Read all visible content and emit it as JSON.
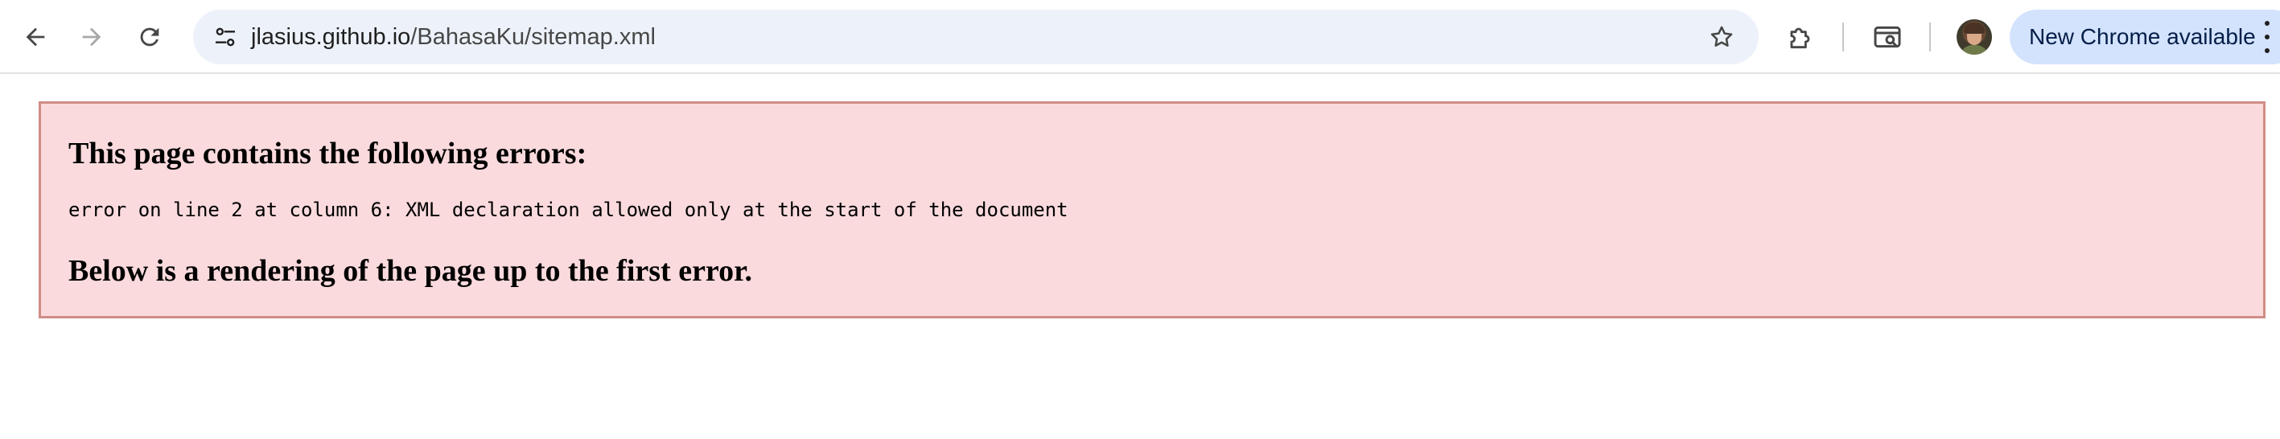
{
  "browser": {
    "nav": {
      "back_icon": "arrow-left-icon",
      "forward_icon": "arrow-right-icon",
      "reload_icon": "reload-icon"
    },
    "omnibox": {
      "site_info_icon": "tune-icon",
      "url_host": "jlasius.github.io",
      "url_path": "/BahasaKu/sitemap.xml",
      "bookmark_icon": "star-icon"
    },
    "toolbar": {
      "extensions_icon": "puzzle-icon",
      "lens_icon": "search-page-icon",
      "update_label": "New Chrome available",
      "menu_icon": "kebab-menu-icon"
    },
    "colors": {
      "omnibox_bg": "#edf2fa",
      "update_bg": "#d3e3fd",
      "error_bg": "#fadadd",
      "error_border": "#d08d86"
    }
  },
  "page": {
    "error_heading": "This page contains the following errors:",
    "error_message": "error on line 2 at column 6: XML declaration allowed only at the start of the document",
    "error_footer": "Below is a rendering of the page up to the first error."
  }
}
